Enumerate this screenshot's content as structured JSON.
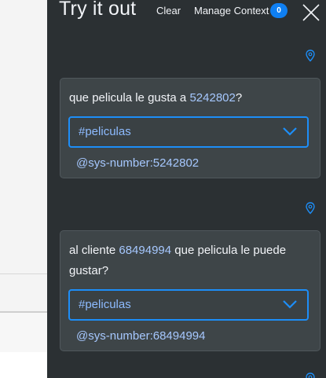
{
  "panel": {
    "title": "Try it out",
    "clear_label": "Clear",
    "manage_context_label": "Manage Context",
    "context_count": "0"
  },
  "messages": [
    {
      "text_before": "que pelicula le gusta a ",
      "entity_value": "5242802",
      "text_after": "?",
      "intent": "#peliculas",
      "entity_tag": "@sys-number:5242802"
    },
    {
      "line1_before": "al cliente ",
      "entity_value": "68494994",
      "line1_after": " que pelicula le puede",
      "line2": "gustar?",
      "intent": "#peliculas",
      "entity_tag": "@sys-number:68494994"
    }
  ],
  "colors": {
    "panel_bg": "#2b3033",
    "card_bg": "#3e4548",
    "accent_blue": "#1d8ef8",
    "entity_text": "#a6c8ff",
    "badge_bg": "#0f7ff2"
  },
  "icons": [
    "location-icon",
    "close-icon",
    "chevron-down-icon"
  ]
}
